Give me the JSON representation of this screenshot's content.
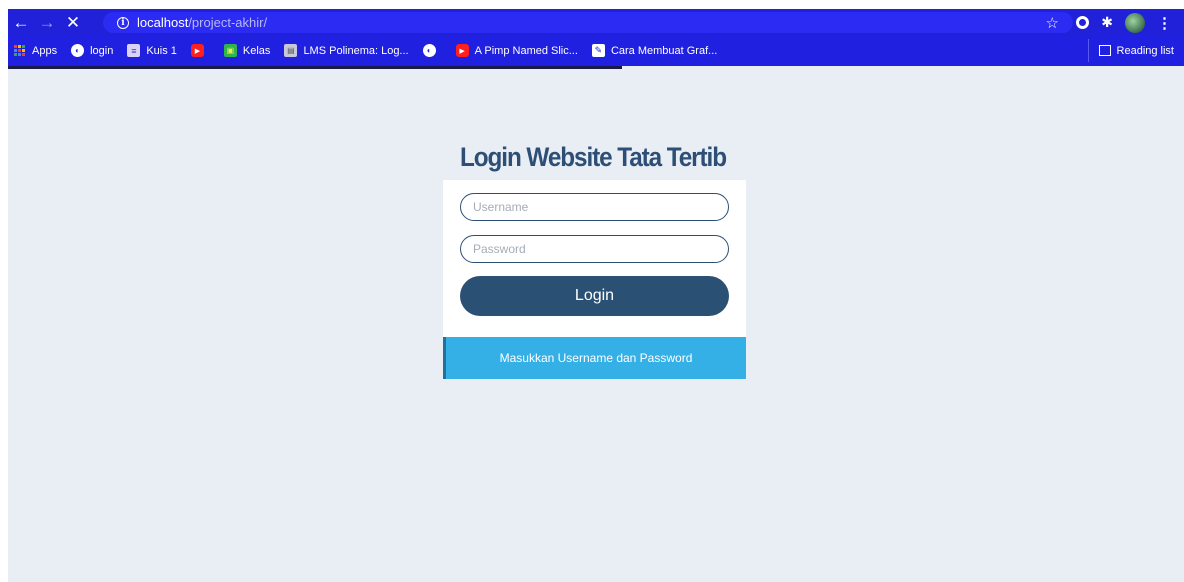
{
  "browser": {
    "url_host": "localhost",
    "url_path": "/project-akhir/",
    "reading_list": "Reading list",
    "bookmarks": [
      {
        "label": "Apps",
        "icon": "apps-grid-icon"
      },
      {
        "label": "login",
        "icon": "globe-icon"
      },
      {
        "label": "Kuis 1",
        "icon": "list-icon"
      },
      {
        "label": "",
        "icon": "youtube-icon"
      },
      {
        "label": "Kelas",
        "icon": "classroom-icon"
      },
      {
        "label": "LMS Polinema: Log...",
        "icon": "lms-icon"
      },
      {
        "label": "",
        "icon": "globe-icon"
      },
      {
        "label": "A Pimp Named Slic...",
        "icon": "youtube-icon"
      },
      {
        "label": "Cara Membuat Graf...",
        "icon": "graf-icon"
      }
    ]
  },
  "login": {
    "title": "Login Website Tata Tertib",
    "username_placeholder": "Username",
    "password_placeholder": "Password",
    "button_label": "Login",
    "message": "Masukkan Username dan Password"
  },
  "colors": {
    "chrome": "#2020e0",
    "page_bg": "#e9eef5",
    "title": "#2e4f75",
    "button": "#2a5174",
    "alert": "#35b0e6"
  }
}
